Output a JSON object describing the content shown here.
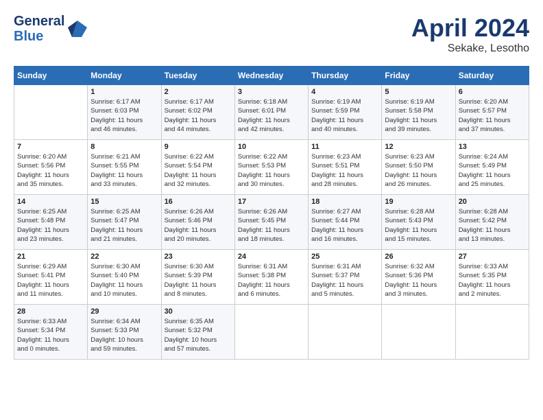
{
  "header": {
    "logo_line1": "General",
    "logo_line2": "Blue",
    "month": "April 2024",
    "location": "Sekake, Lesotho"
  },
  "columns": [
    "Sunday",
    "Monday",
    "Tuesday",
    "Wednesday",
    "Thursday",
    "Friday",
    "Saturday"
  ],
  "weeks": [
    [
      {
        "day": "",
        "info": ""
      },
      {
        "day": "1",
        "info": "Sunrise: 6:17 AM\nSunset: 6:03 PM\nDaylight: 11 hours\nand 46 minutes."
      },
      {
        "day": "2",
        "info": "Sunrise: 6:17 AM\nSunset: 6:02 PM\nDaylight: 11 hours\nand 44 minutes."
      },
      {
        "day": "3",
        "info": "Sunrise: 6:18 AM\nSunset: 6:01 PM\nDaylight: 11 hours\nand 42 minutes."
      },
      {
        "day": "4",
        "info": "Sunrise: 6:19 AM\nSunset: 5:59 PM\nDaylight: 11 hours\nand 40 minutes."
      },
      {
        "day": "5",
        "info": "Sunrise: 6:19 AM\nSunset: 5:58 PM\nDaylight: 11 hours\nand 39 minutes."
      },
      {
        "day": "6",
        "info": "Sunrise: 6:20 AM\nSunset: 5:57 PM\nDaylight: 11 hours\nand 37 minutes."
      }
    ],
    [
      {
        "day": "7",
        "info": "Sunrise: 6:20 AM\nSunset: 5:56 PM\nDaylight: 11 hours\nand 35 minutes."
      },
      {
        "day": "8",
        "info": "Sunrise: 6:21 AM\nSunset: 5:55 PM\nDaylight: 11 hours\nand 33 minutes."
      },
      {
        "day": "9",
        "info": "Sunrise: 6:22 AM\nSunset: 5:54 PM\nDaylight: 11 hours\nand 32 minutes."
      },
      {
        "day": "10",
        "info": "Sunrise: 6:22 AM\nSunset: 5:53 PM\nDaylight: 11 hours\nand 30 minutes."
      },
      {
        "day": "11",
        "info": "Sunrise: 6:23 AM\nSunset: 5:51 PM\nDaylight: 11 hours\nand 28 minutes."
      },
      {
        "day": "12",
        "info": "Sunrise: 6:23 AM\nSunset: 5:50 PM\nDaylight: 11 hours\nand 26 minutes."
      },
      {
        "day": "13",
        "info": "Sunrise: 6:24 AM\nSunset: 5:49 PM\nDaylight: 11 hours\nand 25 minutes."
      }
    ],
    [
      {
        "day": "14",
        "info": "Sunrise: 6:25 AM\nSunset: 5:48 PM\nDaylight: 11 hours\nand 23 minutes."
      },
      {
        "day": "15",
        "info": "Sunrise: 6:25 AM\nSunset: 5:47 PM\nDaylight: 11 hours\nand 21 minutes."
      },
      {
        "day": "16",
        "info": "Sunrise: 6:26 AM\nSunset: 5:46 PM\nDaylight: 11 hours\nand 20 minutes."
      },
      {
        "day": "17",
        "info": "Sunrise: 6:26 AM\nSunset: 5:45 PM\nDaylight: 11 hours\nand 18 minutes."
      },
      {
        "day": "18",
        "info": "Sunrise: 6:27 AM\nSunset: 5:44 PM\nDaylight: 11 hours\nand 16 minutes."
      },
      {
        "day": "19",
        "info": "Sunrise: 6:28 AM\nSunset: 5:43 PM\nDaylight: 11 hours\nand 15 minutes."
      },
      {
        "day": "20",
        "info": "Sunrise: 6:28 AM\nSunset: 5:42 PM\nDaylight: 11 hours\nand 13 minutes."
      }
    ],
    [
      {
        "day": "21",
        "info": "Sunrise: 6:29 AM\nSunset: 5:41 PM\nDaylight: 11 hours\nand 11 minutes."
      },
      {
        "day": "22",
        "info": "Sunrise: 6:30 AM\nSunset: 5:40 PM\nDaylight: 11 hours\nand 10 minutes."
      },
      {
        "day": "23",
        "info": "Sunrise: 6:30 AM\nSunset: 5:39 PM\nDaylight: 11 hours\nand 8 minutes."
      },
      {
        "day": "24",
        "info": "Sunrise: 6:31 AM\nSunset: 5:38 PM\nDaylight: 11 hours\nand 6 minutes."
      },
      {
        "day": "25",
        "info": "Sunrise: 6:31 AM\nSunset: 5:37 PM\nDaylight: 11 hours\nand 5 minutes."
      },
      {
        "day": "26",
        "info": "Sunrise: 6:32 AM\nSunset: 5:36 PM\nDaylight: 11 hours\nand 3 minutes."
      },
      {
        "day": "27",
        "info": "Sunrise: 6:33 AM\nSunset: 5:35 PM\nDaylight: 11 hours\nand 2 minutes."
      }
    ],
    [
      {
        "day": "28",
        "info": "Sunrise: 6:33 AM\nSunset: 5:34 PM\nDaylight: 11 hours\nand 0 minutes."
      },
      {
        "day": "29",
        "info": "Sunrise: 6:34 AM\nSunset: 5:33 PM\nDaylight: 10 hours\nand 59 minutes."
      },
      {
        "day": "30",
        "info": "Sunrise: 6:35 AM\nSunset: 5:32 PM\nDaylight: 10 hours\nand 57 minutes."
      },
      {
        "day": "",
        "info": ""
      },
      {
        "day": "",
        "info": ""
      },
      {
        "day": "",
        "info": ""
      },
      {
        "day": "",
        "info": ""
      }
    ]
  ]
}
